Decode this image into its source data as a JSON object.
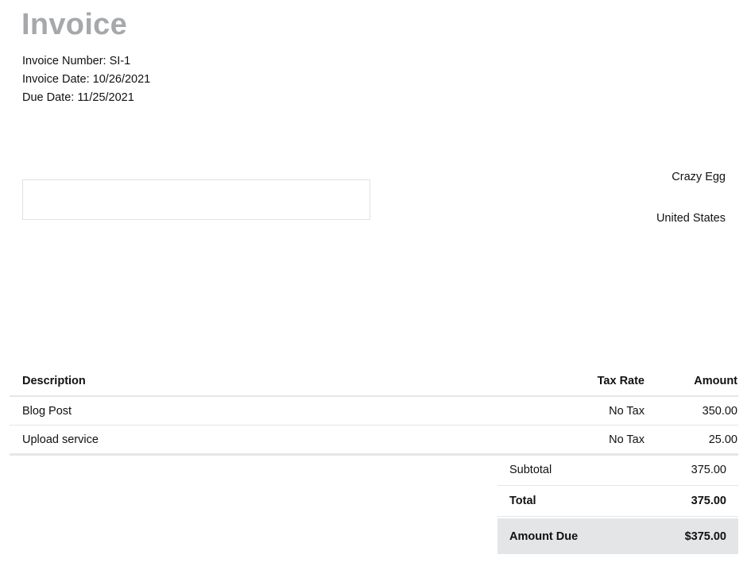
{
  "invoice": {
    "title": "Invoice",
    "number_line": "Invoice Number: SI-1",
    "date_line": "Invoice Date: 10/26/2021",
    "due_line": "Due Date: 11/25/2021"
  },
  "from": {
    "company": "Crazy Egg",
    "country": "United States"
  },
  "items": {
    "headers": {
      "description": "Description",
      "tax_rate": "Tax Rate",
      "amount": "Amount"
    },
    "rows": [
      {
        "description": "Blog Post",
        "tax_rate": "No Tax",
        "amount": "350.00"
      },
      {
        "description": "Upload service",
        "tax_rate": "No Tax",
        "amount": "25.00"
      }
    ]
  },
  "totals": {
    "subtotal_label": "Subtotal",
    "subtotal": "375.00",
    "total_label": "Total",
    "total": "375.00",
    "due_label": "Amount Due",
    "due": "$375.00"
  }
}
